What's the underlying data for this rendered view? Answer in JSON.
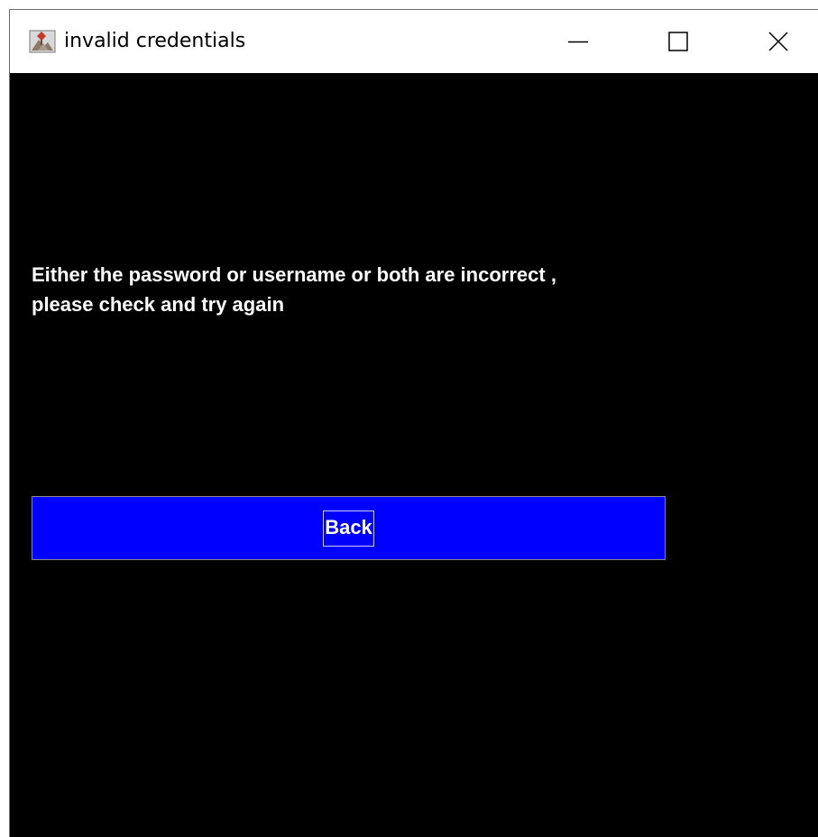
{
  "window": {
    "title": "invalid credentials",
    "controls": {
      "minimize": "minimize-icon",
      "maximize": "maximize-icon",
      "close": "close-icon"
    }
  },
  "dialog": {
    "message": "Either the password or username or both are incorrect , please check and try again",
    "back_label": "Back"
  },
  "colors": {
    "background": "#000000",
    "button": "#0000ff",
    "text": "#ffffff"
  }
}
